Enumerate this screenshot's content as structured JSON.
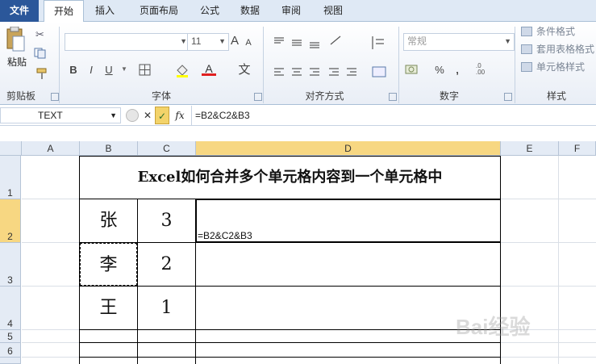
{
  "ribbon": {
    "tabs": [
      "文件",
      "开始",
      "插入",
      "页面布局",
      "公式",
      "数据",
      "审阅",
      "视图"
    ],
    "groups": {
      "clipboard": "剪贴板",
      "font": "字体",
      "alignment": "对齐方式",
      "number": "数字",
      "styles": "样式"
    },
    "paste_label": "粘贴",
    "font_size": "11",
    "number_format": "常规",
    "styles_items": [
      "条件格式",
      "套用表格格式",
      "单元格样式"
    ],
    "bold": "B",
    "italic": "I",
    "underline": "U",
    "wen": "文",
    "percent": "%",
    "comma": ",",
    "inc_decimal": ".0\n.00",
    "font_grow": "A",
    "font_shrink": "A"
  },
  "formula_bar": {
    "name_box": "TEXT",
    "cancel": "✕",
    "enter": "✓",
    "fx": "fx",
    "formula": "=B2&C2&B3"
  },
  "grid": {
    "columns": [
      "A",
      "B",
      "C",
      "D",
      "E",
      "F"
    ],
    "rows": [
      "1",
      "2",
      "3",
      "4",
      "5",
      "6"
    ],
    "title": "Excel如何合并多个单元格内容到一个单元格中",
    "cells": {
      "B2": "张",
      "C2": "3",
      "B3": "李",
      "C3": "2",
      "B4": "王",
      "C4": "1",
      "D2": "=B2&C2&B3"
    }
  },
  "watermark": "Bai经验"
}
